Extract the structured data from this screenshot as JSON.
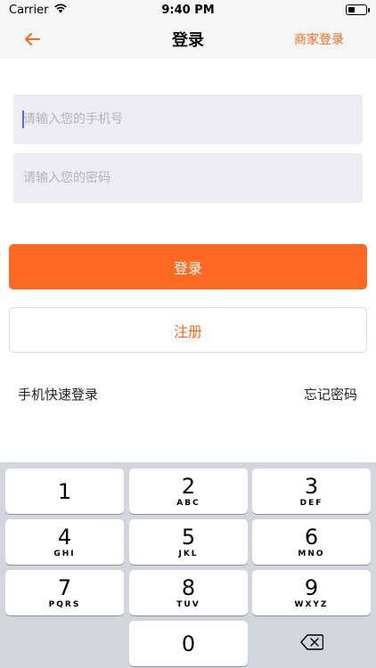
{
  "status_bar": {
    "carrier": "Carrier",
    "time": "9:40 PM",
    "battery_level": 0.35
  },
  "nav": {
    "back_icon": "arrow-left-icon",
    "title": "登录",
    "right_action": "商家登录",
    "accent_color": "#f26b1f"
  },
  "form": {
    "phone_placeholder": "请输入您的手机号",
    "phone_value": "",
    "password_placeholder": "请输入您的密码",
    "password_value": "",
    "login_button": "登录",
    "register_button": "注册",
    "quick_login_link": "手机快速登录",
    "forgot_password_link": "忘记密码",
    "primary_color": "#fe6a23"
  },
  "keyboard": {
    "keys": [
      {
        "digit": "1",
        "letters": ""
      },
      {
        "digit": "2",
        "letters": "ABC"
      },
      {
        "digit": "3",
        "letters": "DEF"
      },
      {
        "digit": "4",
        "letters": "GHI"
      },
      {
        "digit": "5",
        "letters": "JKL"
      },
      {
        "digit": "6",
        "letters": "MNO"
      },
      {
        "digit": "7",
        "letters": "PQRS"
      },
      {
        "digit": "8",
        "letters": "TUV"
      },
      {
        "digit": "9",
        "letters": "WXYZ"
      },
      {
        "digit": "0",
        "letters": ""
      }
    ],
    "delete_icon": "backspace-icon"
  }
}
